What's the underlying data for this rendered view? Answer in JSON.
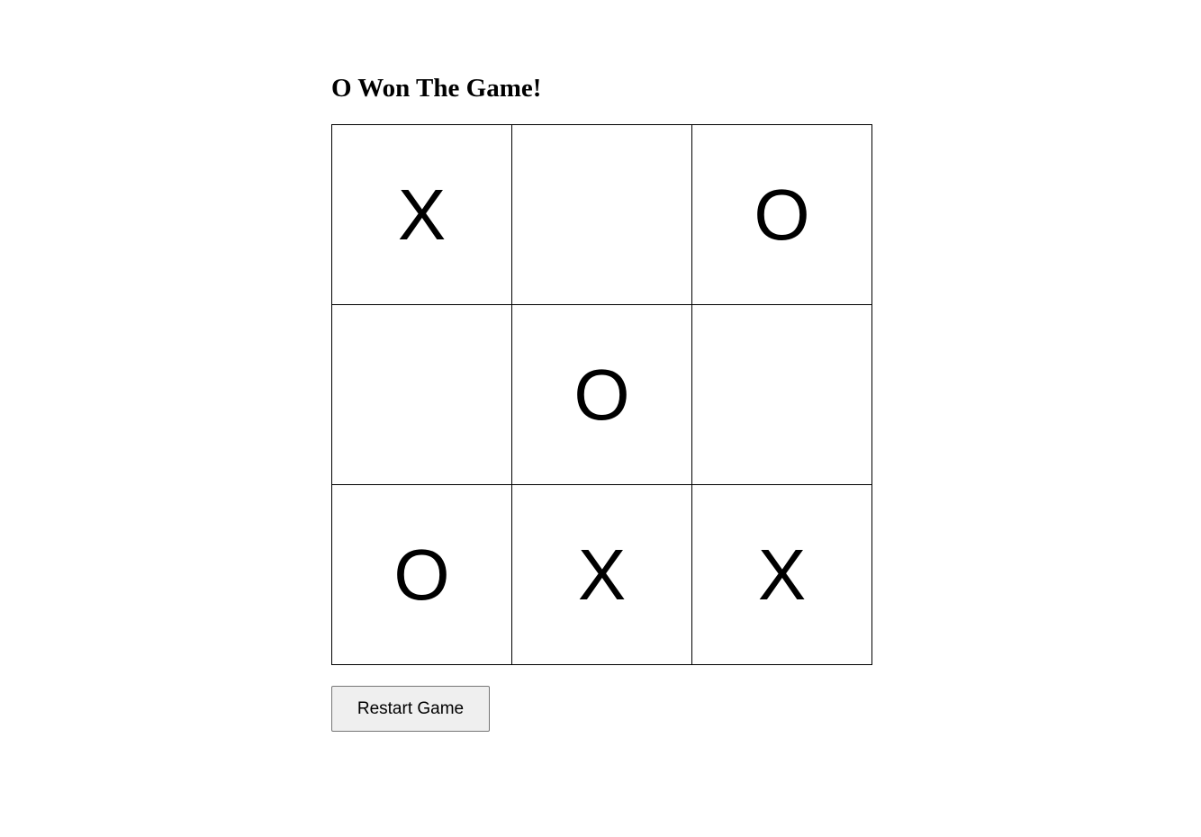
{
  "status": {
    "message": "O Won The Game!"
  },
  "board": {
    "cells": [
      "X",
      "",
      "O",
      "",
      "O",
      "",
      "O",
      "X",
      "X"
    ]
  },
  "controls": {
    "restart_label": "Restart Game"
  }
}
